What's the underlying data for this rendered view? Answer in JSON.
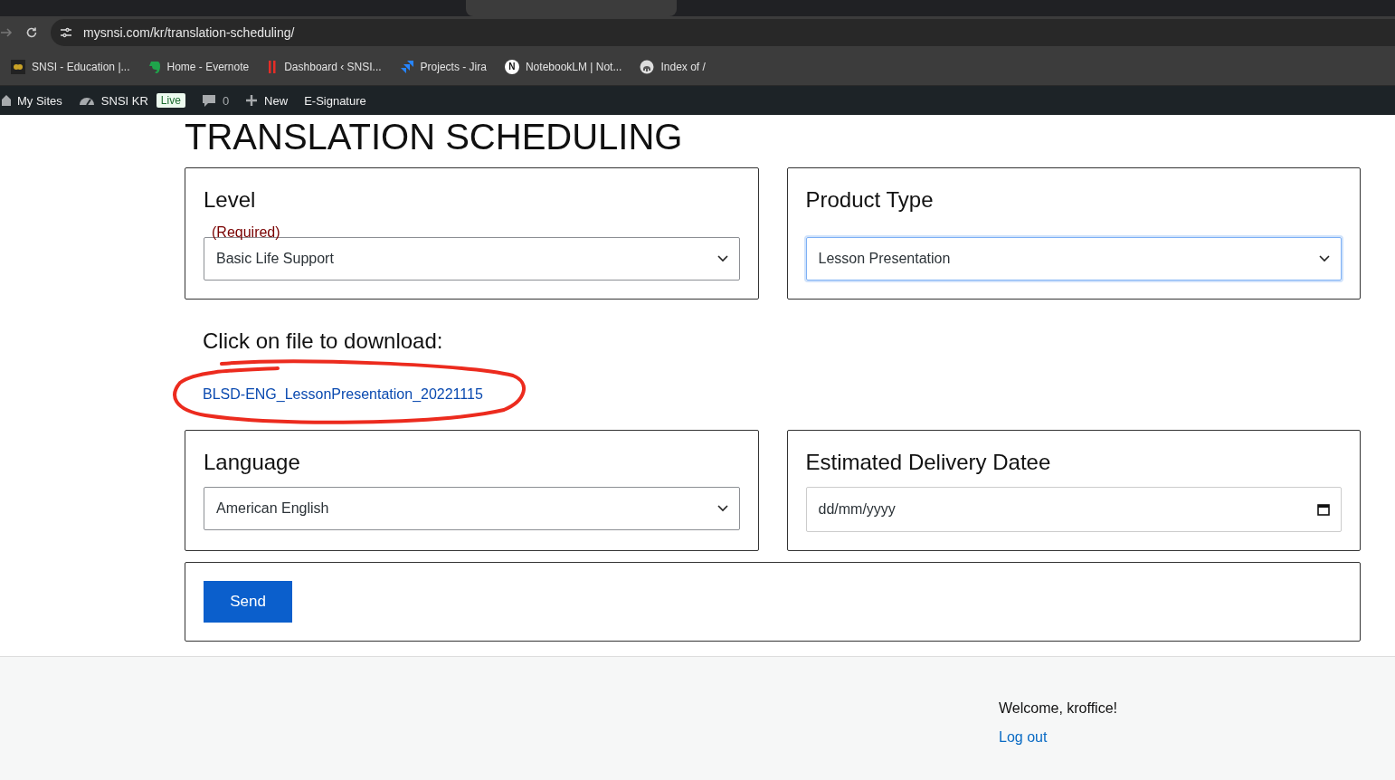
{
  "browser": {
    "url": "mysnsi.com/kr/translation-scheduling/",
    "bookmarks": [
      {
        "label": "SNSI - Education |...",
        "kind": "logo"
      },
      {
        "label": "Home - Evernote",
        "kind": "evernote"
      },
      {
        "label": "Dashboard ‹ SNSI...",
        "kind": "bars"
      },
      {
        "label": "Projects - Jira",
        "kind": "jira"
      },
      {
        "label": "NotebookLM | Not...",
        "kind": "letter",
        "letter": "N"
      },
      {
        "label": "Index of /",
        "kind": "elephant"
      }
    ]
  },
  "admin_bar": {
    "items": [
      {
        "label": "My Sites",
        "kind": "house"
      },
      {
        "label": "SNSI KR",
        "kind": "gauge",
        "badge": "Live"
      },
      {
        "label": "0",
        "kind": "comment"
      },
      {
        "label": "New",
        "kind": "plus"
      },
      {
        "label": "E-Signature",
        "kind": "text"
      }
    ]
  },
  "page": {
    "title": "TRANSLATION SCHEDULING",
    "top_fields": [
      {
        "label": "Level",
        "required": "(Required)",
        "kind": "select",
        "value": "Basic Life Support",
        "focused": false
      },
      {
        "label": "Product Type",
        "kind": "select",
        "value": "Lesson Presentation",
        "focused": true
      }
    ],
    "download": {
      "heading": "Click on file to download:",
      "link": "BLSD-ENG_LessonPresentation_20221115",
      "circled": true
    },
    "bottom_fields": [
      {
        "label": "Language",
        "kind": "select",
        "value": "American English",
        "focused": false
      },
      {
        "label": "Estimated Delivery Datee",
        "kind": "date",
        "placeholder": "dd/mm/yyyy",
        "focused": false
      }
    ],
    "submit": "Send"
  },
  "footer": {
    "welcome": "Welcome, kroffice!",
    "logout": "Log out"
  }
}
